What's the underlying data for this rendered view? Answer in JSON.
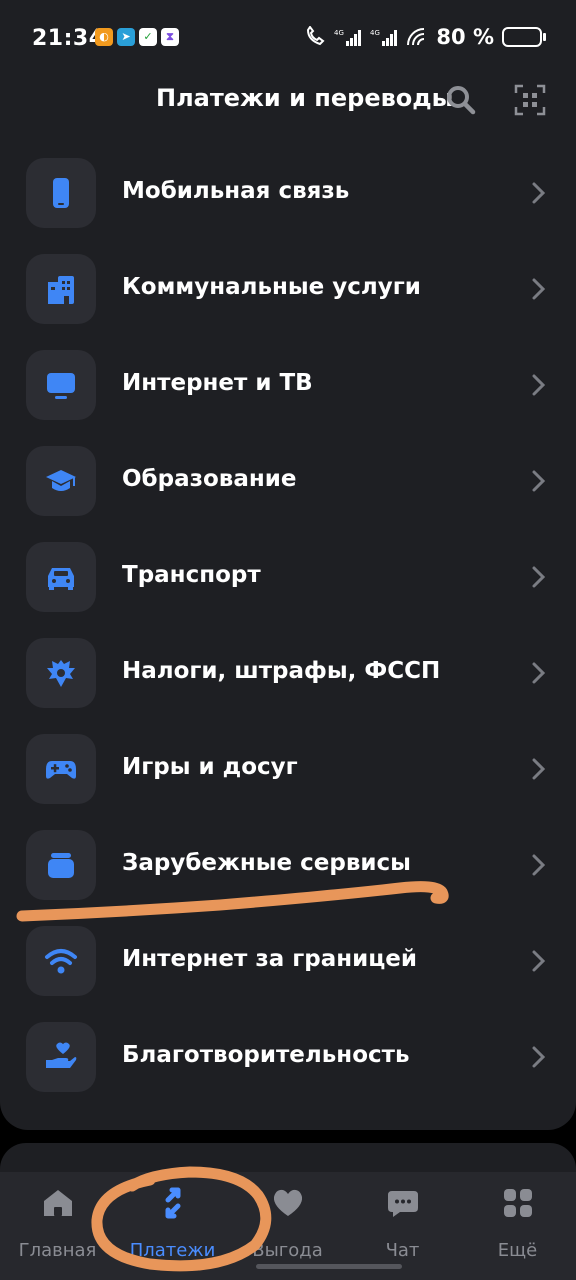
{
  "status": {
    "time": "21:34",
    "battery_percent": "80 %",
    "network_labels": [
      "4G",
      "4G"
    ]
  },
  "header": {
    "title": "Платежи и переводы"
  },
  "list": {
    "items": [
      {
        "label": "Мобильная связь",
        "icon": "mobile-phone-icon"
      },
      {
        "label": "Коммунальные услуги",
        "icon": "building-icon"
      },
      {
        "label": "Интернет и ТВ",
        "icon": "tv-icon"
      },
      {
        "label": "Образование",
        "icon": "graduation-cap-icon"
      },
      {
        "label": "Транспорт",
        "icon": "car-icon"
      },
      {
        "label": "Налоги, штрафы, ФССП",
        "icon": "coat-of-arms-icon"
      },
      {
        "label": "Игры и досуг",
        "icon": "gamepad-icon"
      },
      {
        "label": "Зарубежные сервисы",
        "icon": "stack-icon"
      },
      {
        "label": "Интернет за границей",
        "icon": "wifi-icon"
      },
      {
        "label": "Благотворительность",
        "icon": "charity-hand-icon"
      }
    ]
  },
  "bottom_nav": {
    "items": [
      {
        "label": "Главная",
        "icon": "home-icon",
        "active": false
      },
      {
        "label": "Платежи",
        "icon": "transfer-arrows-icon",
        "active": true
      },
      {
        "label": "Выгода",
        "icon": "heart-icon",
        "active": false
      },
      {
        "label": "Чат",
        "icon": "chat-icon",
        "active": false
      },
      {
        "label": "Ещё",
        "icon": "grid-icon",
        "active": false
      }
    ]
  },
  "colors": {
    "accent": "#4a8dff",
    "annotation": "#e8965a",
    "panel": "#1e1f23"
  }
}
